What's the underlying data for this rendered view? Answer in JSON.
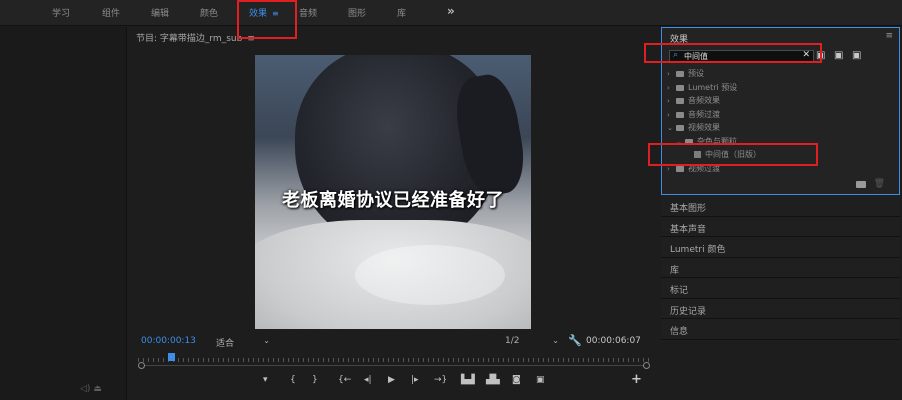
{
  "workspaces": [
    {
      "label": "学习",
      "active": false
    },
    {
      "label": "组件",
      "active": false
    },
    {
      "label": "编辑",
      "active": false
    },
    {
      "label": "颜色",
      "active": false
    },
    {
      "label": "效果",
      "active": true
    },
    {
      "label": "音频",
      "active": false
    },
    {
      "label": "图形",
      "active": false
    },
    {
      "label": "库",
      "active": false
    }
  ],
  "workspace_menu_glyph": "≡",
  "workspace_more": "»",
  "program": {
    "title": "节目: 字幕带描边_rm_sub",
    "menu_glyph": "≡",
    "subtitle": "老板离婚协议已经准备好了",
    "timecode": "00:00:00:13",
    "fit": "适合",
    "resolution": "1/2",
    "duration": "00:00:06:07"
  },
  "transport": {
    "marker": "▾",
    "mark_in": "{",
    "mark_out": "}",
    "go_in": "{←",
    "step_back": "◂|",
    "play": "▶",
    "step_forward": "|▸",
    "go_out": "→}",
    "insert": "▙▟",
    "overwrite": "▟▙",
    "export_frame": "◙",
    "comparison": "▣",
    "add": "+"
  },
  "left_strip_icons": "◁)  ⏏",
  "effects": {
    "title": "效果",
    "menu_glyph": "≡",
    "search_value": "中间值",
    "clear": "✕",
    "tree": [
      {
        "chevron": "›",
        "icon": "folder",
        "label": "预设"
      },
      {
        "chevron": "›",
        "icon": "folder",
        "label": "Lumetri 预设"
      },
      {
        "chevron": "›",
        "icon": "folder",
        "label": "音频效果"
      },
      {
        "chevron": "›",
        "icon": "folder",
        "label": "音频过渡"
      },
      {
        "chevron": "⌄",
        "icon": "folder",
        "label": "视频效果"
      },
      {
        "chevron": "⌄",
        "icon": "folder",
        "label": "杂色与颗粒"
      },
      {
        "chevron": "",
        "icon": "preset",
        "label": "中间值（旧版）"
      },
      {
        "chevron": "›",
        "icon": "folder",
        "label": "视频过渡"
      }
    ]
  },
  "panels": [
    "基本图形",
    "基本声音",
    "Lumetri 颜色",
    "库",
    "标记",
    "历史记录",
    "信息"
  ],
  "colors": {
    "accent": "#3c8ee8",
    "annotation": "#e02020"
  }
}
